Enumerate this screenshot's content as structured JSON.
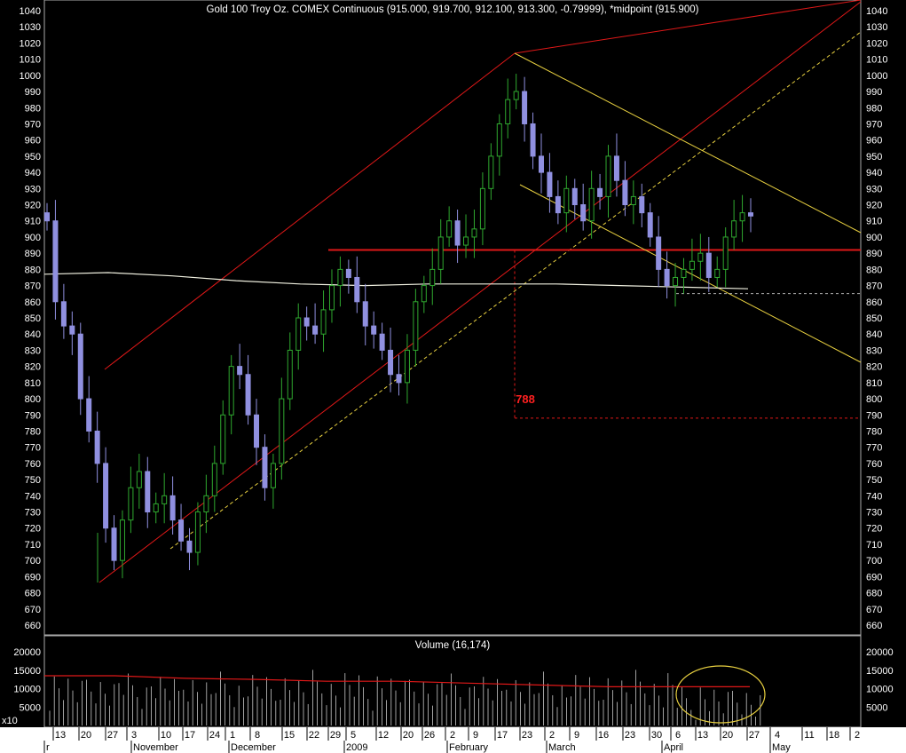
{
  "chart_data": [
    {
      "type": "candlestick",
      "title": "Gold 100 Troy Oz. COMEX Continuous (915.000, 919.700, 912.100, 913.300, -0.79999), *midpoint (915.900)",
      "y_ticks": [
        1040,
        1030,
        1020,
        1010,
        1000,
        990,
        980,
        970,
        960,
        950,
        940,
        930,
        920,
        910,
        900,
        890,
        880,
        870,
        860,
        850,
        840,
        830,
        820,
        810,
        800,
        790,
        780,
        770,
        760,
        750,
        740,
        730,
        720,
        710,
        700,
        690,
        680,
        670,
        660
      ],
      "ylim": [
        655,
        1045
      ],
      "x_tick_labels": [
        "13",
        "20",
        "27",
        "3",
        "10",
        "17",
        "24",
        "1",
        "8",
        "15",
        "22",
        "29",
        "5",
        "12",
        "20",
        "26",
        "2",
        "9",
        "17",
        "23",
        "2",
        "9",
        "16",
        "23",
        "30",
        "6",
        "13",
        "20",
        "27",
        "4",
        "11",
        "18",
        "2"
      ],
      "month_labels": [
        "r",
        "November",
        "December",
        "2009",
        "February",
        "March",
        "April",
        "May"
      ],
      "support_level": 892,
      "target_label": "788",
      "target_value": 788,
      "moving_average_y": [
        877,
        878,
        876,
        873,
        871,
        870,
        871,
        871,
        871,
        870,
        869,
        868
      ],
      "closes": [
        910,
        860,
        845,
        840,
        800,
        780,
        760,
        720,
        700,
        725,
        745,
        755,
        730,
        735,
        740,
        725,
        712,
        705,
        730,
        740,
        760,
        790,
        820,
        815,
        790,
        770,
        745,
        760,
        800,
        830,
        850,
        845,
        840,
        855,
        870,
        880,
        875,
        860,
        845,
        840,
        830,
        815,
        810,
        830,
        860,
        870,
        880,
        900,
        910,
        895,
        900,
        905,
        930,
        950,
        970,
        985,
        990,
        970,
        950,
        940,
        925,
        915,
        930,
        920,
        910,
        930,
        925,
        950,
        935,
        920,
        925,
        915,
        900,
        880,
        870,
        875,
        880,
        885,
        890,
        875,
        880,
        900,
        910,
        915,
        913
      ]
    },
    {
      "type": "bar",
      "title": "Volume (16,174)",
      "y_ticks": [
        20000,
        15000,
        10000,
        5000
      ],
      "ylim": [
        0,
        23000
      ],
      "unit_label": "x10",
      "average_line": [
        13500,
        13500,
        12800,
        12500,
        12000,
        12000,
        11500,
        11000,
        10500,
        10500,
        10500
      ]
    }
  ]
}
